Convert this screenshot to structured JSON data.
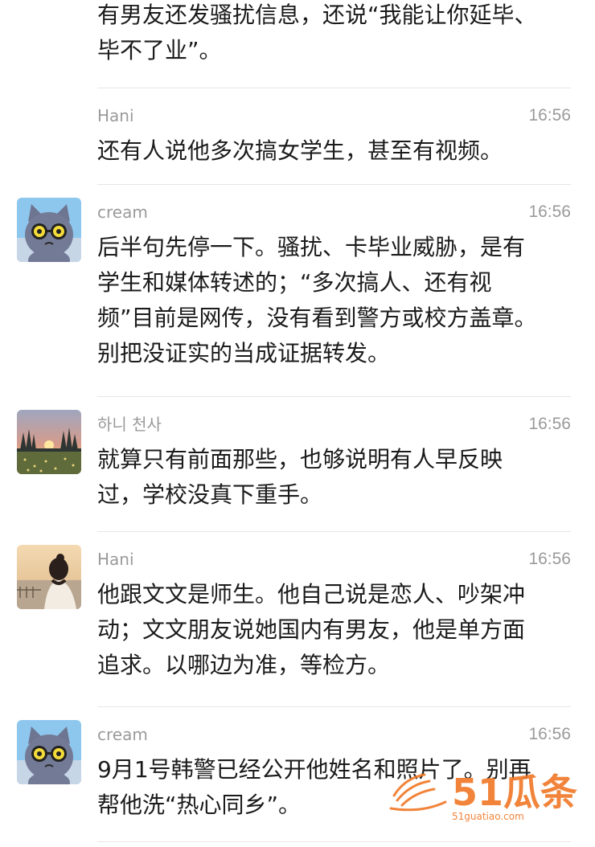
{
  "thread": {
    "partial_top_text": "有男友还发骚扰信息，还说“我能让你延毕、\n毕不了业”。",
    "messages": [
      {
        "author": "Hani",
        "time": "16:56",
        "text": "还有人说他多次搞女学生，甚至有视频。",
        "avatar": "none"
      },
      {
        "author": "cream",
        "time": "16:56",
        "text": "后半句先停一下。骚扰、卡毕业威胁，是有\n学生和媒体转述的；“多次搞人、还有视\n频”目前是网传，没有看到警方或校方盖章。\n别把没证实的当成证据转发。",
        "avatar": "cat-with-sunglasses"
      },
      {
        "author": "하니 천사",
        "time": "16:56",
        "text": "就算只有前面那些，也够说明有人早反映\n过，学校没真下重手。",
        "avatar": "sunset-field"
      },
      {
        "author": "Hani",
        "time": "16:56",
        "text": "他跟文文是师生。他自己说是恋人、吵架冲\n动；文文朋友说她国内有男友，他是单方面\n追求。以哪边为准，等检方。",
        "avatar": "girl-by-sea"
      },
      {
        "author": "cream",
        "time": "16:56",
        "text": "9月1号韩警已经公开他姓名和照片了。别再\n帮他洗“热心同乡”。",
        "avatar": "cat-with-sunglasses"
      }
    ]
  },
  "watermark": {
    "logo_text": "51瓜条",
    "url_text": "51guatiao.com",
    "color": "#f07a2a"
  },
  "colors": {
    "text": "#1b1b1b",
    "meta": "#9a9a9a",
    "divider": "#e6e6e6"
  }
}
